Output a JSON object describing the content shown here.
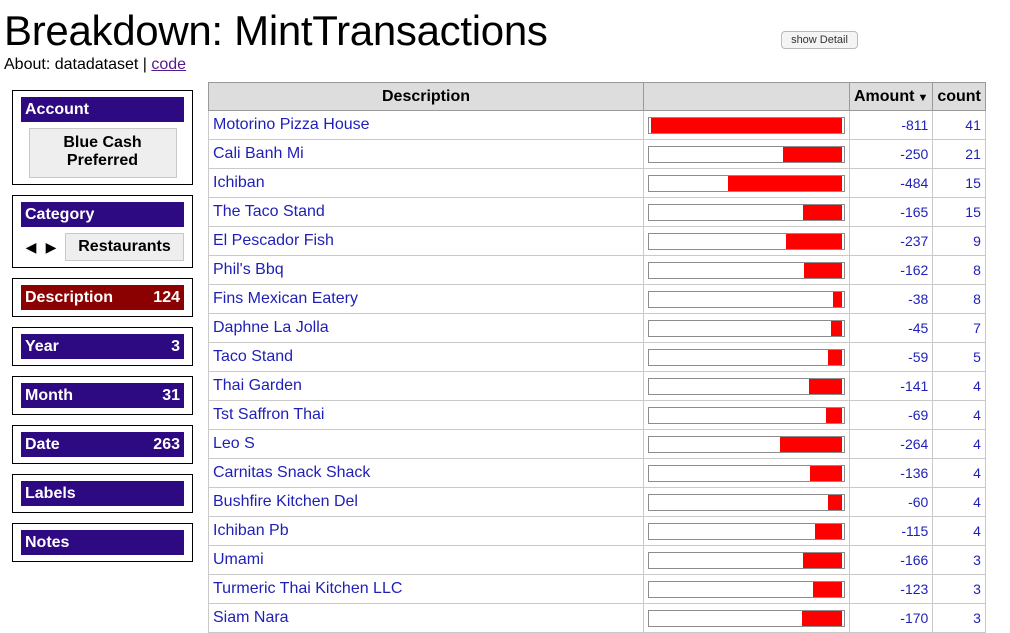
{
  "title": "Breakdown: MintTransactions",
  "about": {
    "prefix": "About: datadataset | ",
    "link": "code"
  },
  "show_detail_label": "show Detail",
  "sidebar": {
    "account": {
      "label": "Account",
      "value": "Blue Cash Preferred"
    },
    "category": {
      "label": "Category",
      "value": "Restaurants",
      "prev_icon": "triangle-left",
      "next_icon": "triangle-right"
    },
    "facets": [
      {
        "label": "Description",
        "count": "124",
        "selected": true
      },
      {
        "label": "Year",
        "count": "3",
        "selected": false
      },
      {
        "label": "Month",
        "count": "31",
        "selected": false
      },
      {
        "label": "Date",
        "count": "263",
        "selected": false
      },
      {
        "label": "Labels",
        "count": "",
        "selected": false
      },
      {
        "label": "Notes",
        "count": "",
        "selected": false
      }
    ]
  },
  "table": {
    "headers": {
      "description": "Description",
      "bar": "",
      "amount": "Amount",
      "count": "count"
    },
    "sort_icon": "caret-down",
    "bar_color": "#ff0000",
    "max_abs_amount": 811,
    "rows": [
      {
        "description": "Motorino Pizza House",
        "amount": "-811",
        "count": "41"
      },
      {
        "description": "Cali Banh Mi",
        "amount": "-250",
        "count": "21"
      },
      {
        "description": "Ichiban",
        "amount": "-484",
        "count": "15"
      },
      {
        "description": "The Taco Stand",
        "amount": "-165",
        "count": "15"
      },
      {
        "description": "El Pescador Fish",
        "amount": "-237",
        "count": "9"
      },
      {
        "description": "Phil's Bbq",
        "amount": "-162",
        "count": "8"
      },
      {
        "description": "Fins Mexican Eatery",
        "amount": "-38",
        "count": "8"
      },
      {
        "description": "Daphne La Jolla",
        "amount": "-45",
        "count": "7"
      },
      {
        "description": "Taco Stand",
        "amount": "-59",
        "count": "5"
      },
      {
        "description": "Thai Garden",
        "amount": "-141",
        "count": "4"
      },
      {
        "description": "Tst Saffron Thai",
        "amount": "-69",
        "count": "4"
      },
      {
        "description": "Leo S",
        "amount": "-264",
        "count": "4"
      },
      {
        "description": "Carnitas Snack Shack",
        "amount": "-136",
        "count": "4"
      },
      {
        "description": "Bushfire Kitchen Del",
        "amount": "-60",
        "count": "4"
      },
      {
        "description": "Ichiban Pb",
        "amount": "-115",
        "count": "4"
      },
      {
        "description": "Umami",
        "amount": "-166",
        "count": "3"
      },
      {
        "description": "Turmeric Thai Kitchen LLC",
        "amount": "-123",
        "count": "3"
      },
      {
        "description": "Siam Nara",
        "amount": "-170",
        "count": "3"
      }
    ]
  }
}
